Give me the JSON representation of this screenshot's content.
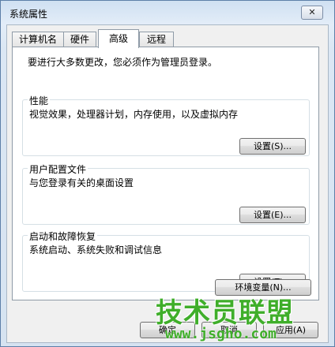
{
  "window": {
    "title": "系统属性",
    "close_label": "✕"
  },
  "tabs": [
    {
      "label": "计算机名"
    },
    {
      "label": "硬件"
    },
    {
      "label": "高级"
    },
    {
      "label": "远程"
    }
  ],
  "active_tab": "高级",
  "advanced": {
    "admin_notice": "要进行大多数更改，您必须作为管理员登录。",
    "groups": [
      {
        "title": "性能",
        "description": "视觉效果，处理器计划，内存使用，以及虚拟内存",
        "button": "设置(S)..."
      },
      {
        "title": "用户配置文件",
        "description": "与您登录有关的桌面设置",
        "button": "设置(E)..."
      },
      {
        "title": "启动和故障恢复",
        "description": "系统启动、系统失败和调试信息",
        "button": "设置(T)..."
      }
    ],
    "env_button": "环境变量(N)..."
  },
  "footer": {
    "ok": "确定",
    "cancel": "取消",
    "apply": "应用(A)"
  },
  "watermark": {
    "brand": "技术员联盟",
    "url": "www.jsgho.com",
    "color": "#3fae2a"
  }
}
